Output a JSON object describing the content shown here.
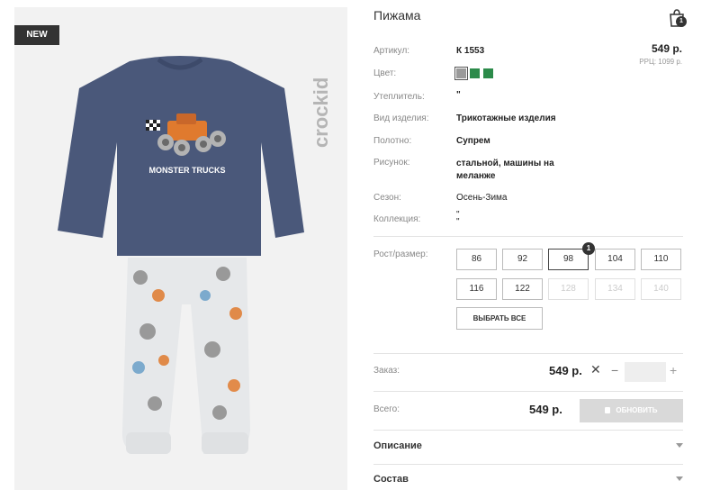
{
  "badge": {
    "new": "NEW"
  },
  "brand": {
    "logo_text": "crockid"
  },
  "product": {
    "title": "Пижама",
    "print_text": "MONSTER TRUCKS"
  },
  "cart": {
    "count": "1"
  },
  "price": {
    "value": "549 р.",
    "rrp": "РРЦ: 1099 р."
  },
  "attributes": [
    {
      "label": "Артикул:",
      "value": "К 1553"
    },
    {
      "label": "Цвет:",
      "value": ""
    },
    {
      "label": "Утеплитель:",
      "value": "\""
    },
    {
      "label": "Вид изделия:",
      "value": "Трикотажные изделия"
    },
    {
      "label": "Полотно:",
      "value": "Супрем"
    },
    {
      "label": "Рисунок:",
      "value": "стальной, машины на\nмеланже"
    },
    {
      "label": "Сезон:",
      "value": "Осень-Зима"
    },
    {
      "label": "Коллекция:",
      "value": "\"\n\""
    }
  ],
  "colors": [
    {
      "hex": "#9a9a9a",
      "selected": true
    },
    {
      "hex": "#2c8b4a",
      "selected": false
    },
    {
      "hex": "#2c8b4a",
      "selected": false
    }
  ],
  "sizes": {
    "label": "Рост/размер:",
    "selected_count": "1",
    "items": [
      {
        "label": "86",
        "state": "available"
      },
      {
        "label": "92",
        "state": "available"
      },
      {
        "label": "98",
        "state": "selected"
      },
      {
        "label": "104",
        "state": "available"
      },
      {
        "label": "110",
        "state": "available"
      },
      {
        "label": "116",
        "state": "available"
      },
      {
        "label": "122",
        "state": "available"
      },
      {
        "label": "128",
        "state": "disabled"
      },
      {
        "label": "134",
        "state": "disabled"
      },
      {
        "label": "140",
        "state": "disabled"
      }
    ],
    "select_all": "ВЫБРАТЬ ВСЕ"
  },
  "order": {
    "label": "Заказ:",
    "price": "549 р.",
    "remove": "✕",
    "minus": "−",
    "plus": "+",
    "quantity": ""
  },
  "total": {
    "label": "Всего:",
    "price": "549 р.",
    "update_button": "ОБНОВИТЬ"
  },
  "accordions": [
    {
      "title": "Описание"
    },
    {
      "title": "Состав"
    }
  ]
}
